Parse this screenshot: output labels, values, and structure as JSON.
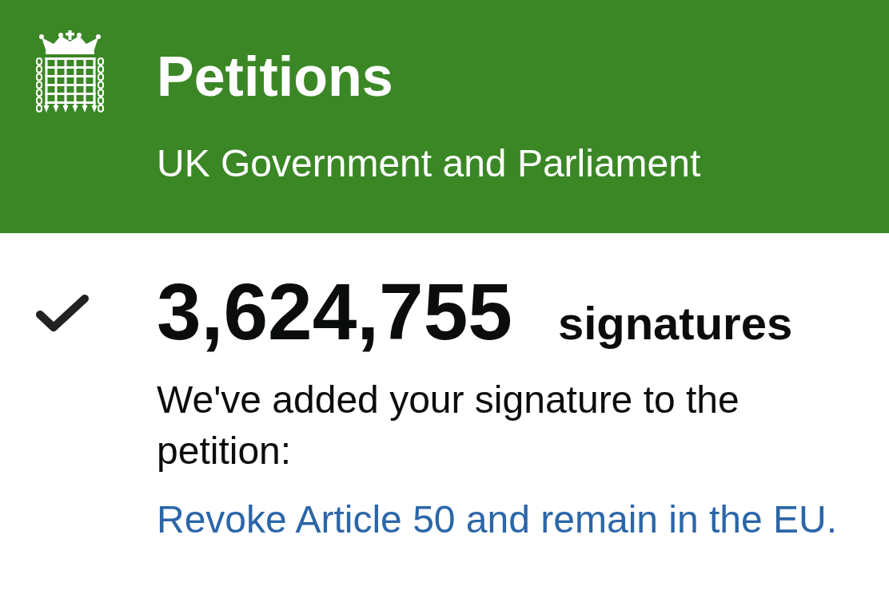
{
  "header": {
    "title": "Petitions",
    "subtitle": "UK Government and Parliament"
  },
  "confirmation": {
    "count": "3,624,755",
    "count_label": "signatures",
    "message": "We've added your signature to the petition:",
    "petition_link": "Revoke Article 50 and remain in the EU."
  }
}
